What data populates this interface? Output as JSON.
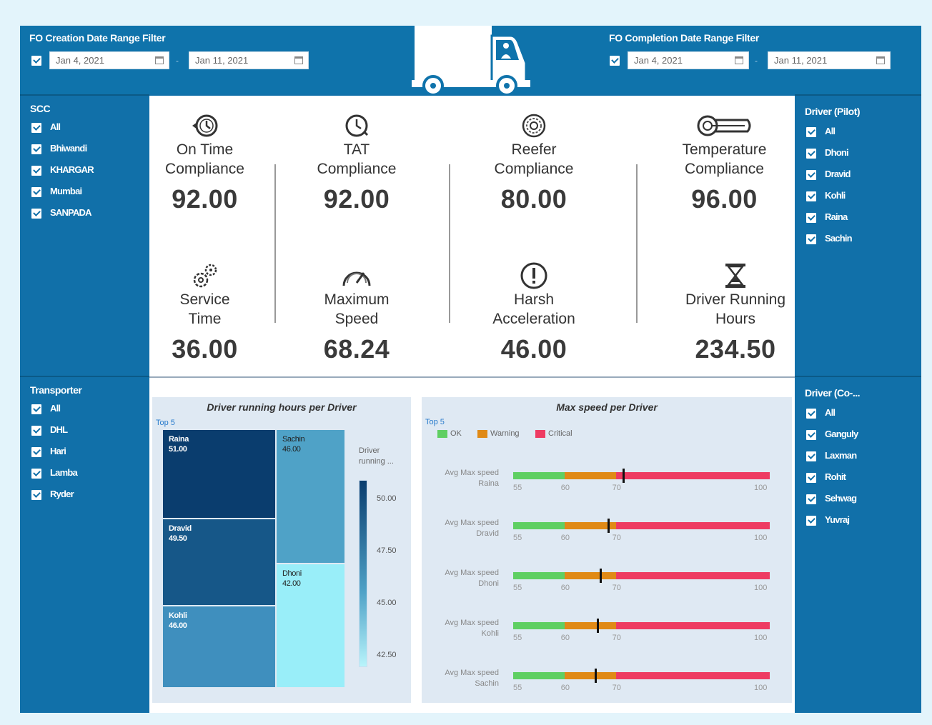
{
  "header": {
    "creation_filter": {
      "title": "FO Creation Date Range Filter",
      "from": "Jan 4, 2021",
      "to": "Jan 11, 2021"
    },
    "completion_filter": {
      "title": "FO Completion Date Range Filter",
      "from": "Jan 4, 2021",
      "to": "Jan 11, 2021"
    }
  },
  "scc": {
    "title": "SCC",
    "items": [
      "All",
      "Bhiwandi",
      "KHARGAR",
      "Mumbai",
      "SANPADA"
    ]
  },
  "transporter": {
    "title": "Transporter",
    "items": [
      "All",
      "DHL",
      "Hari",
      "Lamba",
      "Ryder"
    ]
  },
  "driver_pilot": {
    "title": "Driver (Pilot)",
    "items": [
      "All",
      "Dhoni",
      "Dravid",
      "Kohli",
      "Raina",
      "Sachin"
    ]
  },
  "driver_co": {
    "title": "Driver (Co-...",
    "items": [
      "All",
      "Ganguly",
      "Laxman",
      "Rohit",
      "Sehwag",
      "Yuvraj"
    ]
  },
  "kpis": [
    {
      "label1": "On Time",
      "label2": "Compliance",
      "value": "92.00",
      "icon": "clock-back-icon"
    },
    {
      "label1": "TAT",
      "label2": "Compliance",
      "value": "92.00",
      "icon": "clock-icon"
    },
    {
      "label1": "Reefer",
      "label2": "Compliance",
      "value": "80.00",
      "icon": "reefer-icon"
    },
    {
      "label1": "Temperature",
      "label2": "Compliance",
      "value": "96.00",
      "icon": "thermometer-icon"
    },
    {
      "label1": "Service",
      "label2": "Time",
      "value": "36.00",
      "icon": "gears-icon"
    },
    {
      "label1": "Maximum",
      "label2": "Speed",
      "value": "68.24",
      "icon": "speedometer-icon"
    },
    {
      "label1": "Harsh",
      "label2": "Acceleration",
      "value": "46.00",
      "icon": "exclamation-icon"
    },
    {
      "label1": "Driver Running",
      "label2": "Hours",
      "value": "234.50",
      "icon": "hourglass-icon"
    }
  ],
  "colors": {
    "ok": "#5fcf62",
    "warning": "#e08a16",
    "critical": "#ee3b62"
  },
  "treemap": {
    "title": "Driver running hours per Driver",
    "top_label": "Top 5",
    "legend_title": "Driver running ...",
    "legend_ticks": [
      "50.00",
      "47.50",
      "45.00",
      "42.50"
    ],
    "cells": [
      {
        "name": "Raina",
        "value": "51.00",
        "color": "#0a3d6e"
      },
      {
        "name": "Sachin",
        "value": "46.00",
        "color": "#4fa2c7"
      },
      {
        "name": "Dravid",
        "value": "49.50",
        "color": "#165788"
      },
      {
        "name": "Dhoni",
        "value": "42.00",
        "color": "#99eef9"
      },
      {
        "name": "Kohli",
        "value": "46.00",
        "color": "#3f8fbe"
      }
    ]
  },
  "bullet": {
    "title": "Max speed per Driver",
    "top_label": "Top 5",
    "legend": [
      "OK",
      "Warning",
      "Critical"
    ],
    "row_label": "Avg Max speed",
    "ticks": [
      "55",
      "60",
      "70",
      "100"
    ],
    "rows": [
      {
        "driver": "Raina",
        "value": 71.5
      },
      {
        "driver": "Dravid",
        "value": 68.5
      },
      {
        "driver": "Dhoni",
        "value": 67
      },
      {
        "driver": "Kohli",
        "value": 66.5
      },
      {
        "driver": "Sachin",
        "value": 66
      }
    ]
  }
}
